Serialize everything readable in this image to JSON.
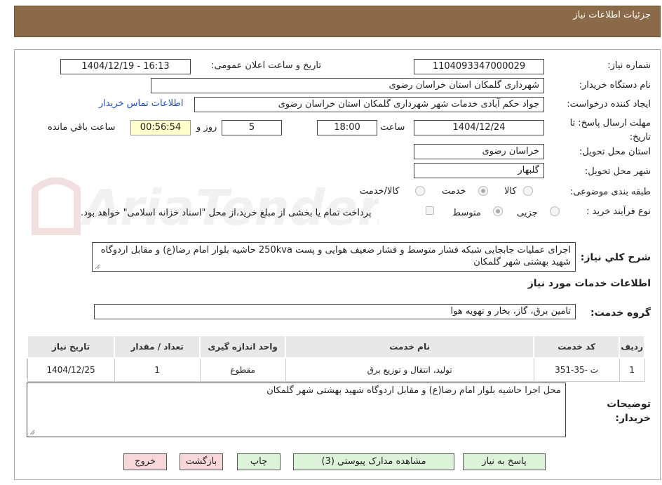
{
  "header": {
    "title": "جزئیات اطلاعات نیاز"
  },
  "fields": {
    "need_number_label": "شماره نیاز:",
    "need_number": "1104093347000029",
    "announce_label": "تاریخ و ساعت اعلان عمومی:",
    "announce_value": "1404/12/19 - 16:13",
    "buyer_org_label": "نام دستگاه خریدار:",
    "buyer_org": "شهرداری گلمکان استان خراسان رضوی",
    "creator_label": "ایجاد کننده درخواست:",
    "creator": "جواد حکم آبادی خدمات شهر شهرداری گلمکان استان خراسان رضوی",
    "contact_link": "اطلاعات تماس خریدار",
    "deadline_label": "مهلت ارسال پاسخ: تا تاریخ:",
    "deadline_date": "1404/12/24",
    "time_label": "ساعت",
    "deadline_time": "18:00",
    "days": "5",
    "days_label": "روز و",
    "remaining": "00:56:54",
    "remaining_label": "ساعت باقي مانده",
    "province_label": "استان محل تحویل:",
    "province": "خراسان رضوی",
    "city_label": "شهر محل تحویل:",
    "city": "گلبهار",
    "category_label": "طبقه بندی موضوعی:",
    "category_options": [
      "کالا",
      "خدمت",
      "کالا/خدمت"
    ],
    "category_selected": "خدمت",
    "process_label": "نوع فرآیند خرید :",
    "process_options": [
      "جزیی",
      "متوسط"
    ],
    "process_selected": "متوسط",
    "payment_note": "پرداخت تمام یا بخشی از مبلغ خرید،از محل \"اسناد خزانه اسلامی\" خواهد بود."
  },
  "summary": {
    "label": "شرح کلي نیاز:",
    "text": "اجرای عملیات جابجایی شبکه فشار متوسط و فشار ضعیف هوایی و پست 250kva  حاشیه بلوار امام رضا(ع) و مقابل اردوگاه شهید بهشتی شهر گلمکان"
  },
  "services": {
    "section_title": "اطلاعات خدمات مورد نیاز",
    "group_label": "گروه خدمت:",
    "group_value": "تامین برق، گاز، بخار و تهویه هوا",
    "columns": [
      "ردیف",
      "کد خدمت",
      "نام خدمت",
      "واحد اندازه گیری",
      "تعداد / مقدار",
      "تاریخ نیاز"
    ],
    "rows": [
      [
        "1",
        "ت -35-351",
        "تولید، انتقال و توزیع برق",
        "مقطوع",
        "1",
        "1404/12/25"
      ]
    ]
  },
  "buyer_notes": {
    "label": "توضیحات خریدار:",
    "text": "محل اجرا حاشیه بلوار امام رضا(ع) و مقابل اردوگاه شهید بهشتی شهر گلمکان"
  },
  "buttons": {
    "reply": "پاسخ به نیاز",
    "attachments": "مشاهده مدارک پیوستي (3)",
    "print": "چاپ",
    "back": "بازگشت",
    "exit": "خروج"
  },
  "colors": {
    "header": "#8a6a48",
    "button_green": "#ddf3d9",
    "button_pink": "#f8d7da",
    "link": "#1f4fbf"
  }
}
